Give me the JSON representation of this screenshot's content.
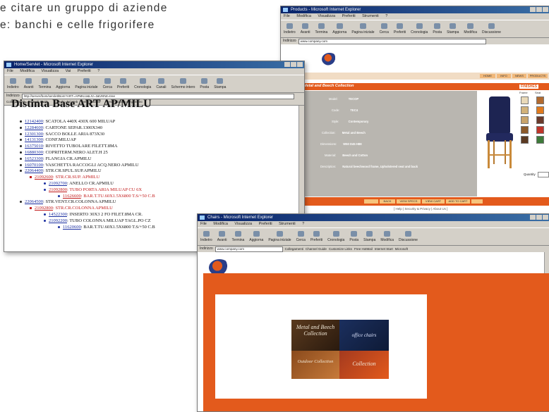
{
  "intro": {
    "line1": "e citare un gruppo di aziende",
    "line2": "e: banchi e celle frigorifere"
  },
  "winA": {
    "title": "Products - Microsoft Internet Explorer",
    "menu": [
      "File",
      "Modifica",
      "Visualizza",
      "Preferiti",
      "Strumenti",
      "?"
    ],
    "toolbar": [
      "Indietro",
      "Avanti",
      "Termina",
      "Aggiorna",
      "Pagina iniziale",
      "Cerca",
      "Preferiti",
      "Cronologia",
      "Posta",
      "Stampa",
      "Modifica",
      "Discussione"
    ],
    "address_label": "Indirizzo",
    "address_value": "www.company.com",
    "nav_tabs": [
      "HOME",
      "INFO",
      "NEWS",
      "PRODUCTS"
    ],
    "collection_title": "Metal and Beech Collection",
    "finishes_label": "FINISHES",
    "finish_cols": [
      "Frame",
      "Seat"
    ],
    "spec_labels": [
      "Model:",
      "Code:",
      "Style:",
      "Collection:",
      "Dimensions:",
      "Material:",
      "Description:"
    ],
    "spec_values": [
      "TECOP",
      "TEC4",
      "Contemporary",
      "Metal and Beech",
      "W50 D45 H88",
      "Beech and Cotton",
      "Natural beechwood frame, Upholstered seat and back"
    ],
    "quantity_label": "Quantity",
    "action_buttons": [
      "",
      "BACK",
      "VIEW SPECS",
      "VIEW CART",
      "ADD TO CART",
      ""
    ],
    "footer": "[ Help | Security & Privacy | About Us ]"
  },
  "winB": {
    "title": "Home/Servlet - Microsoft Internet Explorer",
    "menu": [
      "File",
      "Modifica",
      "Visualizza",
      "Vai",
      "Preferiti",
      "?"
    ],
    "toolbar": [
      "Indietro",
      "Avanti",
      "Termina",
      "Aggiorna",
      "Pagina iniziale",
      "Cerca",
      "Preferiti",
      "Cronologia",
      "Canali",
      "Schermo intero",
      "Posta",
      "Stampa"
    ],
    "address_label": "Indirizzo",
    "address_value": "http://server/bom/servlet/Bom?ART=APMILU&LIV=3&VIEW=tree",
    "links_label": "Collegamenti",
    "links": [
      "Canali Guida",
      "Il meglio del Web",
      "Informazioni",
      "Personalizza collegamenti"
    ],
    "heading": "Distinta Base ART AP/MILU",
    "items": [
      {
        "lvl": 1,
        "code": "12142400",
        "desc": "SCATOLA 440X 430X 600 MILUAP",
        "red": false
      },
      {
        "lvl": 1,
        "code": "12284600",
        "desc": "CARTONE SEPAR.1300X340",
        "red": false
      },
      {
        "lvl": 1,
        "code": "12301300",
        "desc": "SACCO BOLLE ARIA 873X30",
        "red": false
      },
      {
        "lvl": 1,
        "code": "14131300",
        "desc": "CONF.MILUAP",
        "red": false
      },
      {
        "lvl": 1,
        "code": "16375010",
        "desc": "RIVETTO TUBOLARE FILETT.8MA",
        "red": false
      },
      {
        "lvl": 1,
        "code": "16880300",
        "desc": "COPRITERM.NERO ALET.H 25",
        "red": false
      },
      {
        "lvl": 1,
        "code": "16523300",
        "desc": "FLANGIA CR.APMILU",
        "red": false
      },
      {
        "lvl": 1,
        "code": "16070100",
        "desc": "VASCHETTA RACCOGLI ACQ.NERO APMILU",
        "red": false
      },
      {
        "lvl": 1,
        "code": "22064400",
        "desc": "STR.CR.SPUL.SUP.APMILU",
        "red": false
      },
      {
        "lvl": 2,
        "code": "21092600",
        "desc": "STR.CR.SUP. APMILU",
        "red": true
      },
      {
        "lvl": 3,
        "code": "21092700",
        "desc": "ANELLO CR.APMILU",
        "red": false
      },
      {
        "lvl": 3,
        "code": "21092800",
        "desc": "TUBO PORTA ARIA MILUAP CU 6X",
        "red": true
      },
      {
        "lvl": 4,
        "code": "11626600",
        "desc": "BAR.T.TU.60X1.5X6800 T.S/+50 C.B",
        "red": true
      },
      {
        "lvl": 1,
        "code": "22064500",
        "desc": "STR.VENT.CR.COLONNA APMILU",
        "red": false
      },
      {
        "lvl": 2,
        "code": "21092800",
        "desc": "STR.CR.COLONNA APMILU",
        "red": true
      },
      {
        "lvl": 3,
        "code": "14522300",
        "desc": "INSERTO 30X3 2 FO FILET.8MA CR.",
        "red": false
      },
      {
        "lvl": 3,
        "code": "21092200",
        "desc": "TUBO COLONNA MILUAP TAGL.PO CZ",
        "red": false
      },
      {
        "lvl": 4,
        "code": "11620600",
        "desc": "BAR.T.TU.60X1.5X6800 T.S/+50 C.B",
        "red": false
      }
    ]
  },
  "winC": {
    "title": "Chairs - Microsoft Internet Explorer",
    "menu": [
      "File",
      "Modifica",
      "Visualizza",
      "Preferiti",
      "Strumenti",
      "?"
    ],
    "toolbar": [
      "Indietro",
      "Avanti",
      "Termina",
      "Aggiorna",
      "Pagina iniziale",
      "Cerca",
      "Preferiti",
      "Cronologia",
      "Posta",
      "Stampa",
      "Modifica",
      "Discussione"
    ],
    "address_label": "Indirizzo",
    "address_value": "www.company.com",
    "links_label": "Collegamenti",
    "links": [
      "Channel Guide",
      "Customize Links",
      "Free HotMail",
      "Internet Start",
      "Microsoft",
      "Windows Update"
    ],
    "nav_tabs": [
      "HOME",
      "INFO",
      "NEWS",
      "PRODUCTS"
    ],
    "tiles": [
      "Metal and Beech Collection",
      "office chairs",
      "Outdoor Collection",
      "Collection"
    ]
  },
  "colors": {
    "brand_orange": "#e35a1c",
    "brand_navy": "#2a3e88",
    "ie_chrome": "#d4d0c8"
  }
}
